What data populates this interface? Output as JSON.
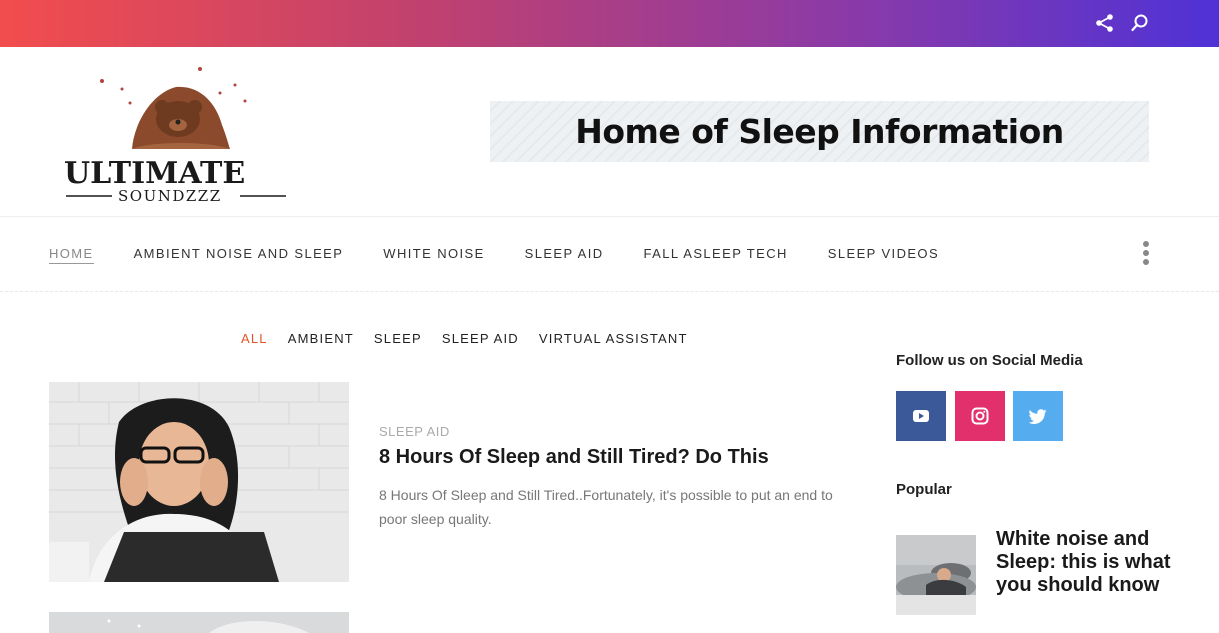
{
  "colors": {
    "gradient_start": "#f24d4d",
    "gradient_end": "#4f32d6",
    "accent": "#e0542a",
    "youtube": "#3b5998",
    "instagram": "#e1306c",
    "twitter": "#55acee"
  },
  "topbar": {
    "icons": [
      "share-icon",
      "search-icon"
    ]
  },
  "logo": {
    "line1": "ULTIMATE",
    "line2": "SOUNDZZZ"
  },
  "banner": {
    "text": "Home of Sleep Information"
  },
  "nav": {
    "items": [
      {
        "label": "HOME"
      },
      {
        "label": "AMBIENT NOISE AND SLEEP"
      },
      {
        "label": "WHITE NOISE"
      },
      {
        "label": "SLEEP AID"
      },
      {
        "label": "FALL ASLEEP TECH"
      },
      {
        "label": "SLEEP VIDEOS"
      }
    ],
    "active_index": 0
  },
  "filters": {
    "items": [
      {
        "label": "ALL"
      },
      {
        "label": "AMBIENT"
      },
      {
        "label": "SLEEP"
      },
      {
        "label": "SLEEP AID"
      },
      {
        "label": "VIRTUAL ASSISTANT"
      }
    ],
    "active_index": 0
  },
  "post": {
    "category": "SLEEP AID",
    "title": "8 Hours Of Sleep and Still Tired? Do This",
    "excerpt": "8 Hours Of Sleep and Still Tired..Fortunately, it's possible to put an end to poor sleep quality."
  },
  "sidebar": {
    "follow_title": "Follow us on Social Media",
    "social": [
      "youtube-icon",
      "instagram-icon",
      "twitter-icon"
    ],
    "popular_title": "Popular",
    "popular_post_title": "White noise and Sleep: this is what you should know"
  }
}
